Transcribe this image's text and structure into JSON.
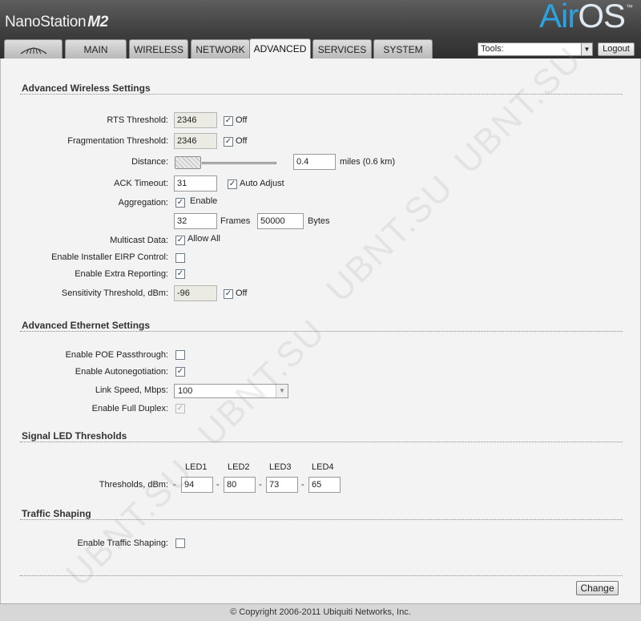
{
  "header": {
    "product_name": "NanoStation",
    "product_model": "M2",
    "brand_air": "Air",
    "brand_os": "OS",
    "brand_tm": "™",
    "tabs": [
      "MAIN",
      "WIRELESS",
      "NETWORK",
      "ADVANCED",
      "SERVICES",
      "SYSTEM"
    ],
    "active_tab": "ADVANCED",
    "tools_label": "Tools:",
    "logout_label": "Logout"
  },
  "advanced_wireless": {
    "title": "Advanced Wireless Settings",
    "rts_label": "RTS Threshold:",
    "rts_value": "2346",
    "rts_off_label": "Off",
    "frag_label": "Fragmentation Threshold:",
    "frag_value": "2346",
    "frag_off_label": "Off",
    "distance_label": "Distance:",
    "distance_value": "0.4",
    "distance_unit": "miles (0.6 km)",
    "ack_label": "ACK Timeout:",
    "ack_value": "31",
    "ack_auto_label": "Auto Adjust",
    "aggregation_label": "Aggregation:",
    "aggregation_enable_label": "Enable",
    "frames_value": "32",
    "frames_label": "Frames",
    "bytes_value": "50000",
    "bytes_label": "Bytes",
    "multicast_label": "Multicast Data:",
    "multicast_allow_label": "Allow All",
    "eirp_label": "Enable Installer EIRP Control:",
    "extra_reporting_label": "Enable Extra Reporting:",
    "sensitivity_label": "Sensitivity Threshold, dBm:",
    "sensitivity_value": "-96",
    "sensitivity_off_label": "Off"
  },
  "advanced_ethernet": {
    "title": "Advanced Ethernet Settings",
    "poe_label": "Enable POE Passthrough:",
    "autoneg_label": "Enable Autonegotiation:",
    "link_speed_label": "Link Speed, Mbps:",
    "link_speed_value": "100",
    "full_duplex_label": "Enable Full Duplex:"
  },
  "signal_led": {
    "title": "Signal LED Thresholds",
    "led_headers": [
      "LED1",
      "LED2",
      "LED3",
      "LED4"
    ],
    "thresholds_label": "Thresholds, dBm:",
    "dash": "-",
    "values": [
      "94",
      "80",
      "73",
      "65"
    ]
  },
  "traffic_shaping": {
    "title": "Traffic Shaping",
    "enable_label": "Enable Traffic Shaping:"
  },
  "change_label": "Change",
  "footer": "© Copyright 2006-2011 Ubiquiti Networks, Inc.",
  "watermark": "UBNT.SU",
  "checkmark_glyph": "✓",
  "select_arrow_glyph": "▼"
}
